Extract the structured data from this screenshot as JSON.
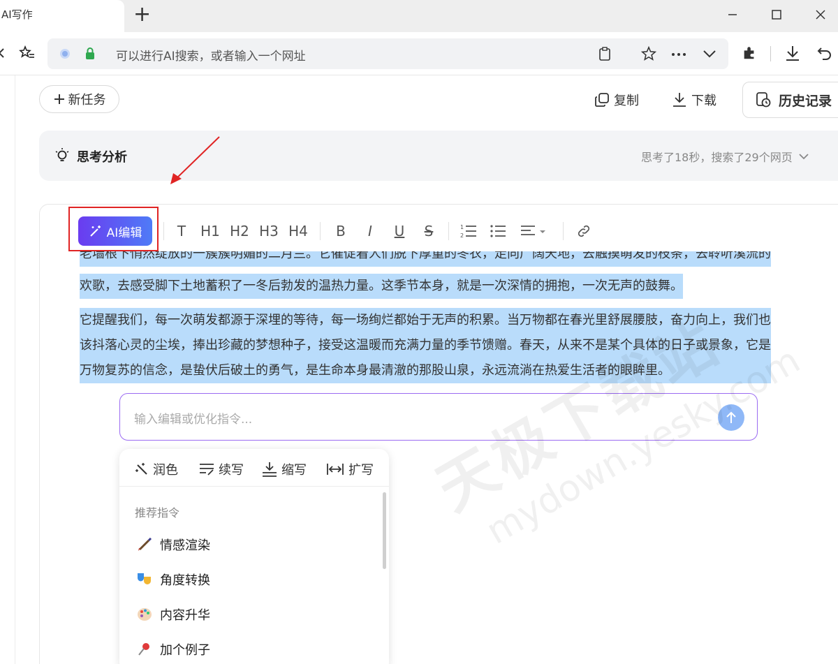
{
  "browser": {
    "tab_title": "AI写作",
    "address_placeholder": "可以进行AI搜索，或者输入一个网址"
  },
  "page": {
    "new_task_label": "新任务",
    "copy_label": "复制",
    "download_label": "下载",
    "history_label": "历史记录"
  },
  "thinking": {
    "title": "思考分析",
    "meta": "思考了18秒，搜索了29个网页"
  },
  "editor": {
    "ai_edit_label": "AI编辑",
    "toolbar": {
      "text": "T",
      "h1": "H1",
      "h2": "H2",
      "h3": "H3",
      "h4": "H4",
      "bold": "B",
      "italic": "I",
      "underline": "U",
      "strike": "S"
    },
    "clipped_line": "老墙根下悄然绽放的一簇簇明媚的二月兰。它催促着人们脱下厚重的冬衣，走向广阔天地，去触摸萌发的枝条，去聆听溪流的",
    "paragraph1_lines": [
      "欢歌，去感受脚下土地蓄积了一冬后勃发的温热力量。这季节本身，就是一次深情的拥抱，一次无声的鼓舞。"
    ],
    "paragraph2_lines": [
      "它提醒我们，每一次萌发都源于深埋的等待，每一场绚烂都始于无声的积累。当万物都在春光里舒展腰肢，奋力向上，我们也",
      "该抖落心灵的尘埃，捧出珍藏的梦想种子，接受这温暖而充满力量的季节馈赠。春天，从来不是某个具体的日子或景象，它是",
      "万物复苏的信念，是蛰伏后破土的勇气，是生命本身最清澈的那股山泉，永远流淌在热爱生活者的眼眸里。"
    ]
  },
  "command": {
    "placeholder": "输入编辑或优化指令..."
  },
  "popup": {
    "actions": [
      "润色",
      "续写",
      "缩写",
      "扩写"
    ],
    "section_title": "推荐指令",
    "items": [
      {
        "label": "情感渲染",
        "icon": "paintbrush-icon"
      },
      {
        "label": "角度转换",
        "icon": "theater-masks-icon"
      },
      {
        "label": "内容升华",
        "icon": "palette-icon"
      },
      {
        "label": "加个例子",
        "icon": "pushpin-icon"
      }
    ]
  },
  "watermark": {
    "line1": "天极下载站",
    "line2": "mydown.yesky.com"
  },
  "colors": {
    "accent_purple": "#6a3cf0",
    "accent_blue": "#4f7bf7",
    "selection": "#b9dcfb",
    "annotation_red": "#e02424"
  }
}
